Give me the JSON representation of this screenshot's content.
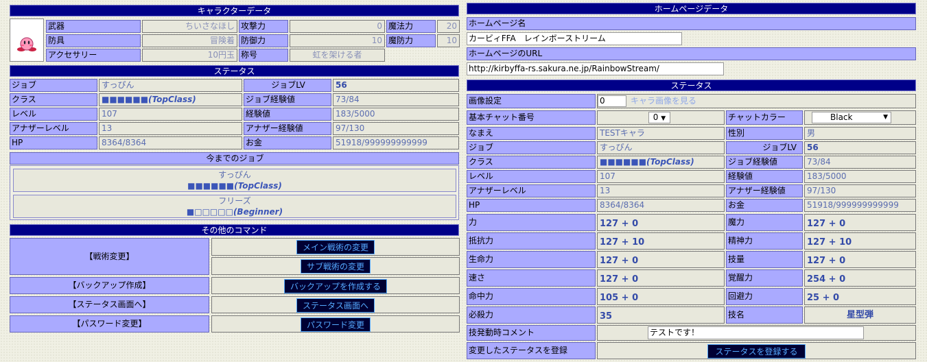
{
  "left": {
    "char_header": "キャラクターデータ",
    "equip": [
      {
        "label": "武器",
        "value": "ちいさなほし",
        "stat_label": "攻撃力",
        "stat_value": "0",
        "stat2_label": "魔法力",
        "stat2_value": "20"
      },
      {
        "label": "防具",
        "value": "冒険着",
        "stat_label": "防御力",
        "stat_value": "10",
        "stat2_label": "魔防力",
        "stat2_value": "10"
      },
      {
        "label": "アクセサリー",
        "value": "10円玉",
        "stat_label": "称号",
        "stat_value": "虹を架ける者"
      }
    ],
    "status_header": "ステータス",
    "status": {
      "job_label": "ジョブ",
      "job": "すっぴん",
      "joblv_label": "ジョブLV",
      "joblv": "56",
      "class_label": "クラス",
      "class": "■■■■■■(TopClass)",
      "jobexp_label": "ジョブ経験値",
      "jobexp": "73/84",
      "level_label": "レベル",
      "level": "107",
      "exp_label": "経験値",
      "exp": "183/5000",
      "alevel_label": "アナザーレベル",
      "alevel": "13",
      "aexp_label": "アナザー経験値",
      "aexp": "97/130",
      "hp_label": "HP",
      "hp": "8364/8364",
      "gold_label": "お金",
      "gold": "51918/999999999999"
    },
    "history_header": "今までのジョブ",
    "history": [
      {
        "job": "すっぴん",
        "rank": "■■■■■■(TopClass)"
      },
      {
        "job": "フリーズ",
        "rank": "■□□□□□(Beginner)"
      }
    ],
    "cmd_header": "その他のコマンド",
    "cmd": {
      "tactics_label": "【戦術変更】",
      "main_tactics_btn": "メイン戦術の変更",
      "sub_tactics_btn": "サブ戦術の変更",
      "backup_label": "【バックアップ作成】",
      "backup_btn": "バックアップを作成する",
      "status_label": "【ステータス画面へ】",
      "status_btn": "ステータス画面へ",
      "pass_label": "【パスワード変更】",
      "pass_btn": "パスワード変更"
    }
  },
  "right": {
    "hp_header": "ホームページデータ",
    "hpname_label": "ホームページ名",
    "hpname_value": "カービィFFA　レインボーストリーム",
    "hpurl_label": "ホームページのURL",
    "hpurl_value": "http://kirbyffa-rs.sakura.ne.jp/RainbowStream/",
    "status_header": "ステータス",
    "image_label": "画像設定",
    "image_value": "0",
    "image_link": "キャラ画像を見る",
    "chat_no_label": "基本チャット番号",
    "chat_no_value": "0",
    "chat_color_label": "チャットカラー",
    "chat_color_value": "Black",
    "name_label": "なまえ",
    "name": "TESTキャラ",
    "sex_label": "性別",
    "sex": "男",
    "job_label": "ジョブ",
    "job": "すっぴん",
    "joblv_label": "ジョブLV",
    "joblv": "56",
    "class_label": "クラス",
    "class": "■■■■■■(TopClass)",
    "jobexp_label": "ジョブ経験値",
    "jobexp": "73/84",
    "level_label": "レベル",
    "level": "107",
    "exp_label": "経験値",
    "exp": "183/5000",
    "alevel_label": "アナザーレベル",
    "alevel": "13",
    "aexp_label": "アナザー経験値",
    "aexp": "97/130",
    "hp_label": "HP",
    "hp": "8364/8364",
    "gold_label": "お金",
    "gold": "51918/999999999999",
    "stats": [
      {
        "l1": "力",
        "v1": "127 + 0",
        "l2": "魔力",
        "v2": "127 + 0"
      },
      {
        "l1": "抵抗力",
        "v1": "127 + 10",
        "l2": "精神力",
        "v2": "127 + 10"
      },
      {
        "l1": "生命力",
        "v1": "127 + 0",
        "l2": "技量",
        "v2": "127 + 0"
      },
      {
        "l1": "速さ",
        "v1": "127 + 0",
        "l2": "覚醒力",
        "v2": "254 + 0"
      },
      {
        "l1": "命中力",
        "v1": "105 + 0",
        "l2": "回避力",
        "v2": "25 + 0"
      },
      {
        "l1": "必殺力",
        "v1": "35",
        "l2": "技名",
        "v2": "星型弾"
      }
    ],
    "comment_label": "技発動時コメント",
    "comment_value": "テストです！",
    "register_label": "変更したステータスを登録",
    "register_btn": "ステータスを登録する"
  }
}
